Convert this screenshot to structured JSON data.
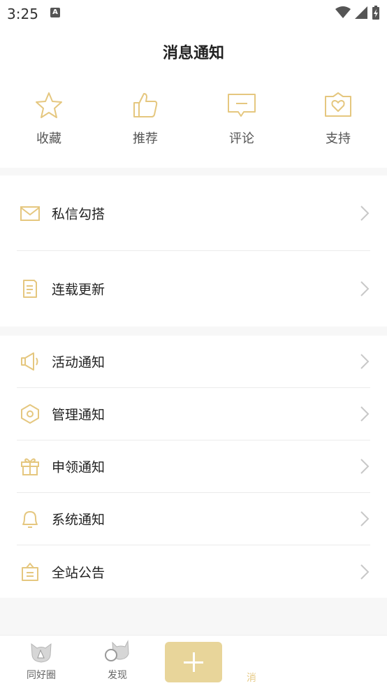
{
  "status": {
    "time": "3:25",
    "badge": "A"
  },
  "title": "消息通知",
  "quick": [
    {
      "label": "收藏",
      "icon": "star-icon"
    },
    {
      "label": "推荐",
      "icon": "thumbs-up-icon"
    },
    {
      "label": "评论",
      "icon": "comment-icon"
    },
    {
      "label": "支持",
      "icon": "heart-box-icon"
    }
  ],
  "group1": [
    {
      "label": "私信勾搭",
      "icon": "mail-icon"
    },
    {
      "label": "连载更新",
      "icon": "book-icon"
    }
  ],
  "group2": [
    {
      "label": "活动通知",
      "icon": "speaker-icon"
    },
    {
      "label": "管理通知",
      "icon": "hexagon-icon"
    },
    {
      "label": "申领通知",
      "icon": "gift-icon"
    },
    {
      "label": "系统通知",
      "icon": "bell-icon"
    },
    {
      "label": "全站公告",
      "icon": "notice-board-icon"
    }
  ],
  "tabs": [
    {
      "label": "同好圈"
    },
    {
      "label": "发现"
    },
    {
      "label": "消"
    }
  ],
  "colors": {
    "accent": "#e5c77f",
    "add_button": "#e8d59a"
  }
}
